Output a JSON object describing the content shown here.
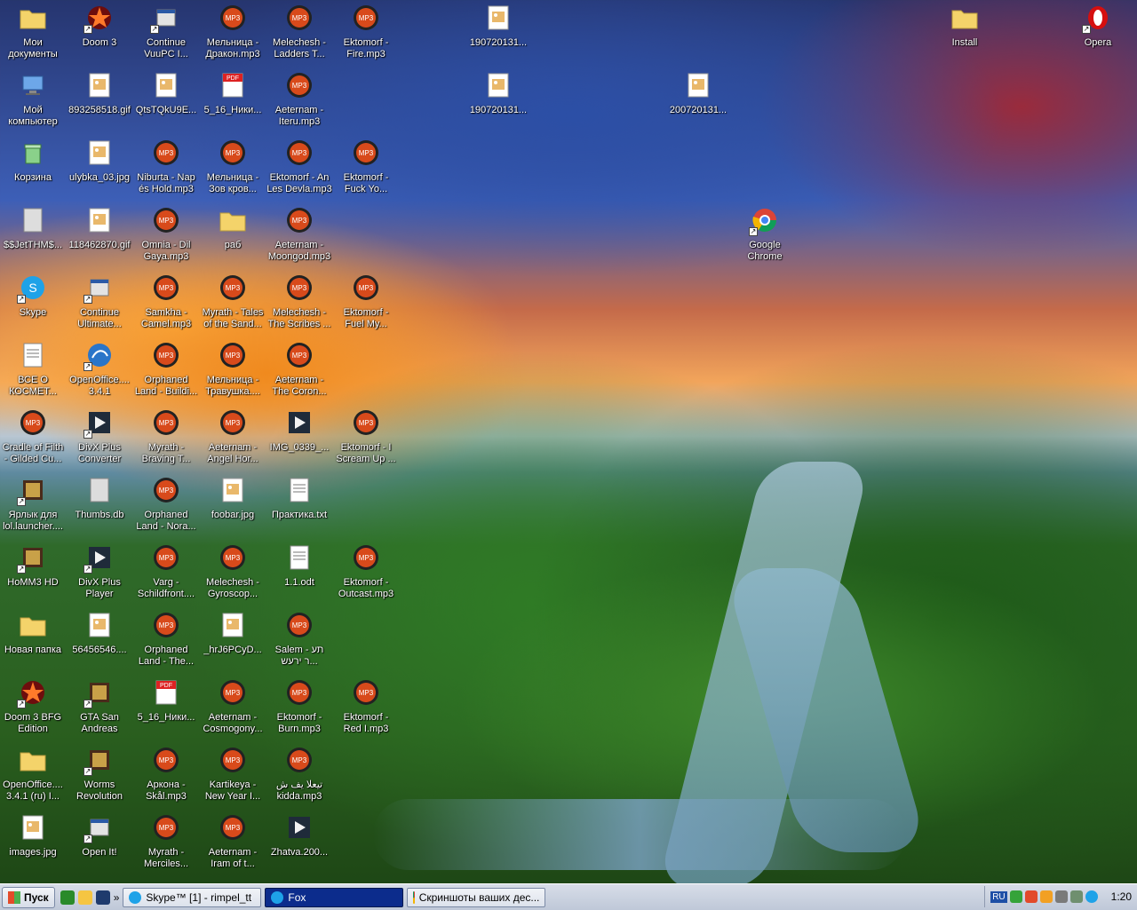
{
  "desktop": {
    "icons": [
      {
        "label": "Мои\nдокументы",
        "type": "folder",
        "shortcut": false
      },
      {
        "label": "Мой\nкомпьютер",
        "type": "computer",
        "shortcut": false
      },
      {
        "label": "Корзина",
        "type": "recycle",
        "shortcut": false
      },
      {
        "label": "$$JetTHM$...",
        "type": "file",
        "shortcut": false
      },
      {
        "label": "Skype",
        "type": "skype",
        "shortcut": true
      },
      {
        "label": "ВСЕ О\nКОСМЕТ...",
        "type": "document",
        "shortcut": false
      },
      {
        "label": "Cradle of Filth\n- Gilded Cu...",
        "type": "mp3",
        "shortcut": false
      },
      {
        "label": "Ярлык для\nlol.launcher....",
        "type": "game",
        "shortcut": true
      },
      {
        "label": "HoMM3 HD",
        "type": "game",
        "shortcut": true
      },
      {
        "label": "Новая папка",
        "type": "folder",
        "shortcut": false
      },
      {
        "label": "Doom 3 BFG\nEdition",
        "type": "doom",
        "shortcut": true
      },
      {
        "label": "OpenOffice....\n3.4.1 (ru) I...",
        "type": "folder",
        "shortcut": false
      },
      {
        "label": "images.jpg",
        "type": "image",
        "shortcut": false
      },
      {
        "label": "Doom 3",
        "type": "doom",
        "shortcut": true
      },
      {
        "label": "893258518.gif",
        "type": "image",
        "shortcut": false
      },
      {
        "label": "ulybka_03.jpg",
        "type": "image",
        "shortcut": false
      },
      {
        "label": "118462870.gif",
        "type": "image",
        "shortcut": false
      },
      {
        "label": "Continue\nUltimate...",
        "type": "app",
        "shortcut": true
      },
      {
        "label": "OpenOffice....\n3.4.1",
        "type": "openoffice",
        "shortcut": true
      },
      {
        "label": "DivX Plus\nConverter",
        "type": "divx",
        "shortcut": true
      },
      {
        "label": "Thumbs.db",
        "type": "file",
        "shortcut": false
      },
      {
        "label": "DivX Plus\nPlayer",
        "type": "divx",
        "shortcut": true
      },
      {
        "label": "56456546....",
        "type": "image",
        "shortcut": false
      },
      {
        "label": "GTA San\nAndreas",
        "type": "game",
        "shortcut": true
      },
      {
        "label": "Worms\nRevolution",
        "type": "game",
        "shortcut": true
      },
      {
        "label": "Open It!",
        "type": "app",
        "shortcut": true
      },
      {
        "label": "Continue\nVuuPC I...",
        "type": "app",
        "shortcut": true
      },
      {
        "label": "QtsTQkU9E...",
        "type": "image",
        "shortcut": false
      },
      {
        "label": "Niburta - Nap\nés Hold.mp3",
        "type": "mp3",
        "shortcut": false
      },
      {
        "label": "Omnia - Dil\nGaya.mp3",
        "type": "mp3",
        "shortcut": false
      },
      {
        "label": "Samkha -\nCamel.mp3",
        "type": "mp3",
        "shortcut": false
      },
      {
        "label": "Orphaned\nLand - Buildi...",
        "type": "mp3",
        "shortcut": false
      },
      {
        "label": "Myrath -\nBraving T...",
        "type": "mp3",
        "shortcut": false
      },
      {
        "label": "Orphaned\nLand - Nora...",
        "type": "mp3",
        "shortcut": false
      },
      {
        "label": "Varg -\nSchildfront....",
        "type": "mp3",
        "shortcut": false
      },
      {
        "label": "Orphaned\nLand - The...",
        "type": "mp3",
        "shortcut": false
      },
      {
        "label": "5_16_Ники...",
        "type": "pdf",
        "shortcut": false
      },
      {
        "label": "Аркона -\nSkål.mp3",
        "type": "mp3",
        "shortcut": false
      },
      {
        "label": "Myrath -\nMerciles...",
        "type": "mp3",
        "shortcut": false
      },
      {
        "label": "Мельница -\nДракон.mp3",
        "type": "mp3",
        "shortcut": false
      },
      {
        "label": "5_16_Ники...",
        "type": "pdf",
        "shortcut": false
      },
      {
        "label": "Мельница -\nЗов кров...",
        "type": "mp3",
        "shortcut": false
      },
      {
        "label": "раб",
        "type": "folder",
        "shortcut": false
      },
      {
        "label": "Myrath - Tales\nof the Sand...",
        "type": "mp3",
        "shortcut": false
      },
      {
        "label": "Мельница -\nТравушка....",
        "type": "mp3",
        "shortcut": false
      },
      {
        "label": "Aeternam -\nAngel Hor...",
        "type": "mp3",
        "shortcut": false
      },
      {
        "label": "foobar.jpg",
        "type": "image",
        "shortcut": false
      },
      {
        "label": "Melechesh -\nGyroscop...",
        "type": "mp3",
        "shortcut": false
      },
      {
        "label": "_hrJ6PCyD...",
        "type": "image",
        "shortcut": false
      },
      {
        "label": "Aeternam -\nCosmogony...",
        "type": "mp3",
        "shortcut": false
      },
      {
        "label": "Kartikeya -\nNew Year I...",
        "type": "mp3",
        "shortcut": false
      },
      {
        "label": "Aeternam -\nIram of t...",
        "type": "mp3",
        "shortcut": false
      },
      {
        "label": "Melechesh -\nLadders T...",
        "type": "mp3",
        "shortcut": false
      },
      {
        "label": "Aeternam -\nIteru.mp3",
        "type": "mp3",
        "shortcut": false
      },
      {
        "label": "Ektomorf - An\nLes Devla.mp3",
        "type": "mp3",
        "shortcut": false
      },
      {
        "label": "Aeternam -\nMoongod.mp3",
        "type": "mp3",
        "shortcut": false
      },
      {
        "label": "Melechesh -\nThe Scribes ...",
        "type": "mp3",
        "shortcut": false
      },
      {
        "label": "Aeternam -\nThe Coron...",
        "type": "mp3",
        "shortcut": false
      },
      {
        "label": "IMG_0339_...",
        "type": "divx",
        "shortcut": false
      },
      {
        "label": "Практика.txt",
        "type": "document",
        "shortcut": false
      },
      {
        "label": "1.1.odt",
        "type": "document",
        "shortcut": false
      },
      {
        "label": "Salem - תע\nר ירעש...",
        "type": "mp3",
        "shortcut": false
      },
      {
        "label": "Ektomorf -\nBurn.mp3",
        "type": "mp3",
        "shortcut": false
      },
      {
        "label": "تيعلا يف ش\nkidda.mp3",
        "type": "mp3",
        "shortcut": false
      },
      {
        "label": "Zhatva.200...",
        "type": "divx",
        "shortcut": false
      },
      {
        "label": "Ektomorf -\nFire.mp3",
        "type": "mp3",
        "shortcut": false
      },
      {
        "label": "Ektomorf -\nFuck Yo...",
        "type": "mp3",
        "shortcut": false
      },
      {
        "label": "Ektomorf -\nFuel My...",
        "type": "mp3",
        "shortcut": false
      },
      {
        "label": "Ektomorf - I\nScream Up ...",
        "type": "mp3",
        "shortcut": false
      },
      {
        "label": "Ektomorf -\nOutcast.mp3",
        "type": "mp3",
        "shortcut": false
      },
      {
        "label": "Ektomorf -\nRed I.mp3",
        "type": "mp3",
        "shortcut": false
      },
      {
        "label": "190720131...",
        "type": "image",
        "shortcut": false
      },
      {
        "label": "190720131...",
        "type": "image",
        "shortcut": false
      },
      {
        "label": "200720131...",
        "type": "image",
        "shortcut": false
      },
      {
        "label": "Google\nChrome",
        "type": "chrome",
        "shortcut": true
      },
      {
        "label": "Install",
        "type": "folder",
        "shortcut": false
      },
      {
        "label": "Opera",
        "type": "opera",
        "shortcut": true
      }
    ]
  },
  "taskbar": {
    "start_label": "Пуск",
    "chevron": "»",
    "tasks": [
      {
        "label": "Skype™ [1] - rimpel_tt",
        "icon": "skype",
        "active": false
      },
      {
        "label": "Fox",
        "icon": "skype",
        "active": true
      },
      {
        "label": "Скриншоты ваших дес...",
        "icon": "chrome",
        "active": false
      }
    ],
    "lang": "RU",
    "clock": "1:20"
  },
  "colors": {
    "mp3": "#d84a1b",
    "folder": "#f4d36a",
    "skype": "#1ea2e8",
    "chrome_red": "#db4437",
    "chrome_yellow": "#f4b400",
    "chrome_green": "#0f9d58",
    "opera": "#d50f0f"
  }
}
